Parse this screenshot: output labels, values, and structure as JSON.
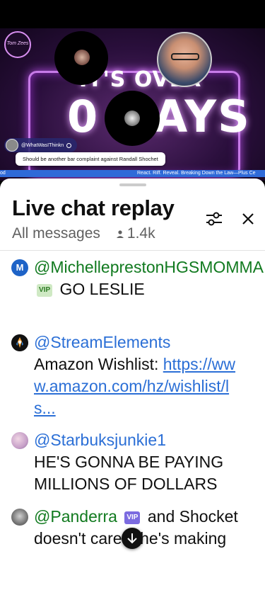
{
  "video": {
    "channel_logo_text": "Tom Zees",
    "headline_top": "IT'S OVER",
    "headline_big": "0 DAYS",
    "pill_username": "@WhatWasIThinkn",
    "overlay_message": "Should be another bar complaint against Randall Shochet",
    "ticker_left": "od",
    "ticker_right": "React. Riff. Reveal. Breaking Down the Law—Plus Ce"
  },
  "panel": {
    "title": "Live chat replay",
    "filter_label": "All messages",
    "viewer_count": "1.4k"
  },
  "messages": [
    {
      "author": "@MichelleprestonHGSMOMMA",
      "badge": "VIP",
      "text": "GO LESLIE",
      "avatar_letter": "M"
    },
    {
      "author": "@StreamElements",
      "text": "Amazon Wishlist: ",
      "link": "https://www.amazon.com/hz/wishlist/ls..."
    },
    {
      "author": "@Starbuksjunkie1",
      "text": "HE'S GONNA BE PAYING MILLIONS OF DOLLARS"
    },
    {
      "author": "@Panderra",
      "badge": "VIP",
      "text": "and Shocket doesn't care .. he's making money"
    }
  ],
  "colors": {
    "author_blue": "#2b6fd6",
    "author_vip_green": "#117a1f",
    "ticker_blue": "#2f6ad8"
  },
  "icons": [
    "tune-icon",
    "close-icon",
    "person-icon",
    "arrow-down-icon",
    "verified-check-icon"
  ]
}
